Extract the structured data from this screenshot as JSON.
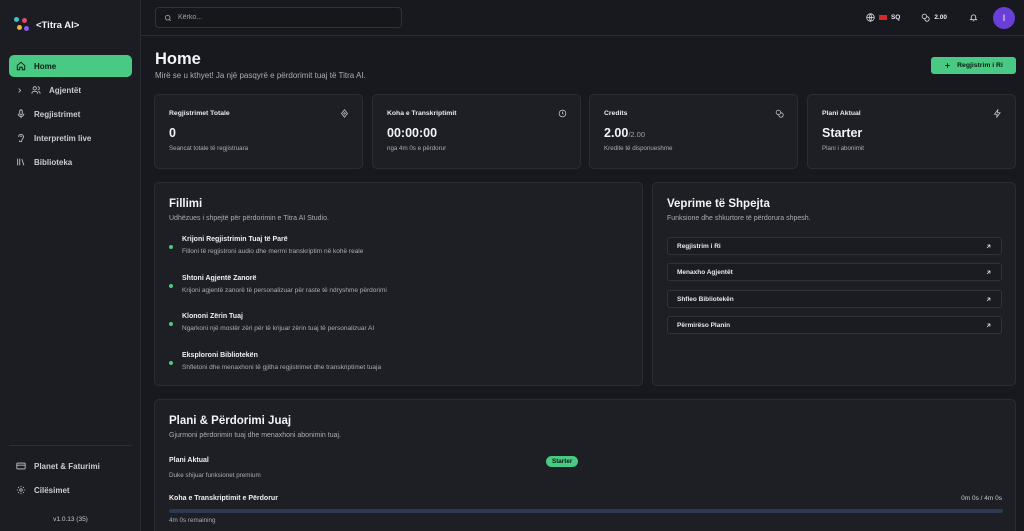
{
  "app": {
    "name": "<Titra AI>",
    "version": "v1.0.13 (35)"
  },
  "sidebar": {
    "items": [
      {
        "label": "Home",
        "icon": "home-icon",
        "active": true
      },
      {
        "label": "Agjentët",
        "icon": "users-icon",
        "active": false
      },
      {
        "label": "Regjistrimet",
        "icon": "mic-icon",
        "active": false
      },
      {
        "label": "Interpretim live",
        "icon": "ear-icon",
        "active": false
      },
      {
        "label": "Biblioteka",
        "icon": "library-icon",
        "active": false
      }
    ],
    "bottom": [
      {
        "label": "Planet & Faturimi",
        "icon": "billing-icon"
      },
      {
        "label": "Cilësimet",
        "icon": "gear-icon"
      }
    ]
  },
  "topbar": {
    "search_placeholder": "Kërko...",
    "language": "SQ",
    "credits": "2.00",
    "avatar_initial": "I"
  },
  "header": {
    "title": "Home",
    "subtitle": "Mirë se u kthyet! Ja një pasqyrë e përdorimit tuaj të Titra AI.",
    "new_button": "Regjistrim i Ri"
  },
  "stats": [
    {
      "label": "Regjistrimet Totale",
      "value": "0",
      "value_suffix": "",
      "desc": "Seancat totale të regjistruara",
      "icon": "target-icon"
    },
    {
      "label": "Koha e Transkriptimit",
      "value": "00:00:00",
      "value_suffix": "",
      "desc": "nga 4m 0s e përdorur",
      "icon": "clock-icon"
    },
    {
      "label": "Credits",
      "value": "2.00",
      "value_suffix": "/2.00",
      "desc": "Kredite të disponueshme",
      "icon": "coins-icon"
    },
    {
      "label": "Plani Aktual",
      "value": "Starter",
      "value_suffix": "",
      "desc": "Plani i abonimit",
      "icon": "bolt-icon"
    }
  ],
  "getting_started": {
    "title": "Fillimi",
    "subtitle": "Udhëzues i shpejtë për përdorimin e Titra AI Studio.",
    "steps": [
      {
        "title": "Krijoni Regjistrimin Tuaj të Parë",
        "desc": "Filloni të regjistroni audio dhe merrni transkriptim në kohë reale"
      },
      {
        "title": "Shtoni Agjentë Zanorë",
        "desc": "Krijoni agjentë zanorë të personalizuar për raste të ndryshme përdorimi"
      },
      {
        "title": "Klononi Zërin Tuaj",
        "desc": "Ngarkoni një mostër zëri për të krijuar zërin tuaj të personalizuar AI"
      },
      {
        "title": "Eksploroni Bibliotekën",
        "desc": "Shfletoni dhe menaxhoni të gjitha regjistrimet dhe transkriptimet tuaja"
      }
    ]
  },
  "quick_actions": {
    "title": "Veprime të Shpejta",
    "subtitle": "Funksione dhe shkurtore të përdorura shpesh.",
    "items": [
      "Regjistrim i Ri",
      "Menaxho Agjentët",
      "Shfleo Bibliotekën",
      "Përmirëso Planin"
    ]
  },
  "plan_usage": {
    "title": "Plani & Përdorimi Juaj",
    "subtitle": "Gjurmoni përdorimin tuaj dhe menaxhoni abonimin tuaj.",
    "current_plan_label": "Plani Aktual",
    "current_plan_desc": "Duke shijuar funksionet premium",
    "plan_badge": "Starter",
    "time_label": "Koha e Transkriptimit e Përdorur",
    "time_value": "0m 0s / 4m 0s",
    "remaining": "4m 0s remaining",
    "usage_fraction": 0
  },
  "colors": {
    "accent": "#48c984",
    "avatar": "#6a3fd8",
    "background": "#17191f",
    "card": "#1d1f24"
  }
}
